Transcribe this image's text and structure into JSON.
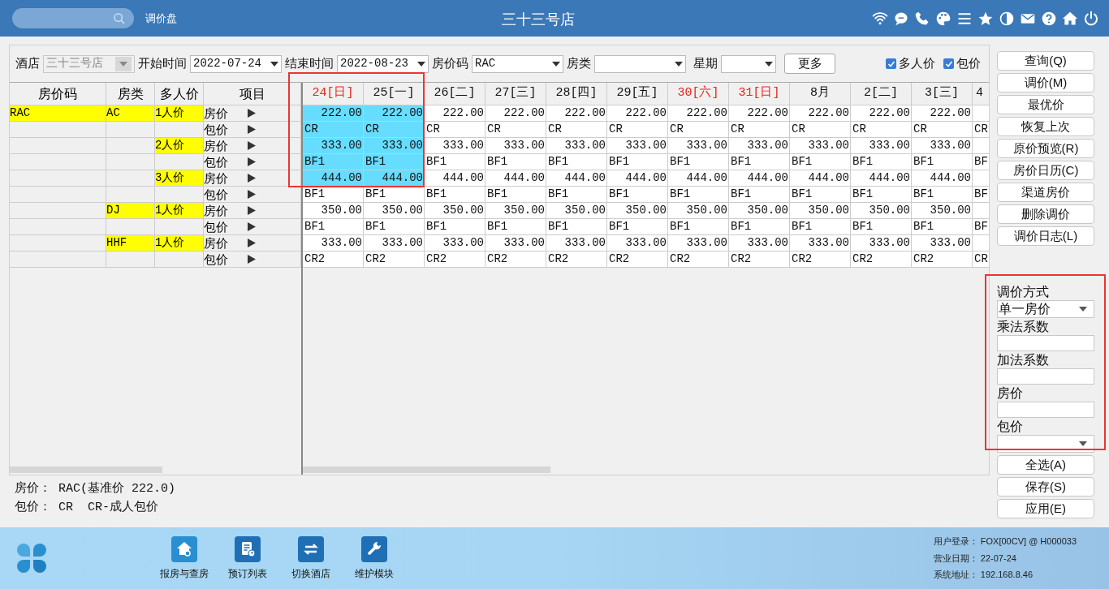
{
  "topbar": {
    "module_title": "调价盘",
    "store_title": "三十三号店"
  },
  "filters": {
    "hotel": {
      "label": "酒店",
      "value": "三十三号店",
      "disabled": true
    },
    "start": {
      "label": "开始时间",
      "value": "2022-07-24"
    },
    "end": {
      "label": "结束时间",
      "value": "2022-08-23"
    },
    "rate_code": {
      "label": "房价码",
      "value": "RAC"
    },
    "room_type": {
      "label": "房类"
    },
    "weekday": {
      "label": "星期"
    },
    "more_button": "更多",
    "checkboxes": [
      {
        "label": "多人价",
        "checked": true
      },
      {
        "label": "包价",
        "checked": true
      }
    ]
  },
  "left_columns": [
    "房价码",
    "房类",
    "多人价",
    "项目"
  ],
  "dates": [
    {
      "label": "24[日]",
      "weekend": true
    },
    {
      "label": "25[一]",
      "weekend": false
    },
    {
      "label": "26[二]",
      "weekend": false
    },
    {
      "label": "27[三]",
      "weekend": false
    },
    {
      "label": "28[四]",
      "weekend": false
    },
    {
      "label": "29[五]",
      "weekend": false
    },
    {
      "label": "30[六]",
      "weekend": true
    },
    {
      "label": "31[日]",
      "weekend": true
    },
    {
      "label": "8月",
      "weekend": false
    },
    {
      "label": "2[二]",
      "weekend": false
    },
    {
      "label": "3[三]",
      "weekend": false
    },
    {
      "label": "4",
      "weekend": false
    }
  ],
  "rows": [
    {
      "kind": "rate",
      "code": "RAC",
      "room_type": "AC",
      "persons": "1人价",
      "item": "房价",
      "cells": [
        {
          "text": "222.00",
          "selected": true
        },
        {
          "text": "222.00",
          "selected": true
        },
        {
          "text": "222.00",
          "selected": false
        },
        {
          "text": "222.00",
          "selected": false
        },
        {
          "text": "222.00",
          "selected": false
        },
        {
          "text": "222.00",
          "selected": false
        },
        {
          "text": "222.00",
          "selected": false
        },
        {
          "text": "222.00",
          "selected": false
        },
        {
          "text": "222.00",
          "selected": false
        },
        {
          "text": "222.00",
          "selected": false
        },
        {
          "text": "222.00",
          "selected": false
        }
      ]
    },
    {
      "kind": "package",
      "item": "包价",
      "cells": [
        {
          "text": "CR",
          "selected": true
        },
        {
          "text": "CR",
          "selected": true
        },
        {
          "text": "CR",
          "selected": false
        },
        {
          "text": "CR",
          "selected": false
        },
        {
          "text": "CR",
          "selected": false
        },
        {
          "text": "CR",
          "selected": false
        },
        {
          "text": "CR",
          "selected": false
        },
        {
          "text": "CR",
          "selected": false
        },
        {
          "text": "CR",
          "selected": false
        },
        {
          "text": "CR",
          "selected": false
        },
        {
          "text": "CR",
          "selected": false
        },
        {
          "text": "CR",
          "selected": false
        }
      ]
    },
    {
      "kind": "rate",
      "persons": "2人价",
      "item": "房价",
      "cells": [
        {
          "text": "333.00",
          "selected": true
        },
        {
          "text": "333.00",
          "selected": true
        },
        {
          "text": "333.00",
          "selected": false
        },
        {
          "text": "333.00",
          "selected": false
        },
        {
          "text": "333.00",
          "selected": false
        },
        {
          "text": "333.00",
          "selected": false
        },
        {
          "text": "333.00",
          "selected": false
        },
        {
          "text": "333.00",
          "selected": false
        },
        {
          "text": "333.00",
          "selected": false
        },
        {
          "text": "333.00",
          "selected": false
        },
        {
          "text": "333.00",
          "selected": false
        }
      ]
    },
    {
      "kind": "package",
      "item": "包价",
      "cells": [
        {
          "text": "BF1",
          "selected": true
        },
        {
          "text": "BF1",
          "selected": true
        },
        {
          "text": "BF1",
          "selected": false
        },
        {
          "text": "BF1",
          "selected": false
        },
        {
          "text": "BF1",
          "selected": false
        },
        {
          "text": "BF1",
          "selected": false
        },
        {
          "text": "BF1",
          "selected": false
        },
        {
          "text": "BF1",
          "selected": false
        },
        {
          "text": "BF1",
          "selected": false
        },
        {
          "text": "BF1",
          "selected": false
        },
        {
          "text": "BF1",
          "selected": false
        },
        {
          "text": "BF",
          "selected": false
        }
      ]
    },
    {
      "kind": "rate",
      "persons": "3人价",
      "item": "房价",
      "cells": [
        {
          "text": "444.00",
          "selected": true
        },
        {
          "text": "444.00",
          "selected": true
        },
        {
          "text": "444.00",
          "selected": false
        },
        {
          "text": "444.00",
          "selected": false
        },
        {
          "text": "444.00",
          "selected": false
        },
        {
          "text": "444.00",
          "selected": false
        },
        {
          "text": "444.00",
          "selected": false
        },
        {
          "text": "444.00",
          "selected": false
        },
        {
          "text": "444.00",
          "selected": false
        },
        {
          "text": "444.00",
          "selected": false
        },
        {
          "text": "444.00",
          "selected": false
        }
      ]
    },
    {
      "kind": "package",
      "item": "包价",
      "cells": [
        {
          "text": "BF1",
          "selected": false
        },
        {
          "text": "BF1",
          "selected": false
        },
        {
          "text": "BF1",
          "selected": false
        },
        {
          "text": "BF1",
          "selected": false
        },
        {
          "text": "BF1",
          "selected": false
        },
        {
          "text": "BF1",
          "selected": false
        },
        {
          "text": "BF1",
          "selected": false
        },
        {
          "text": "BF1",
          "selected": false
        },
        {
          "text": "BF1",
          "selected": false
        },
        {
          "text": "BF1",
          "selected": false
        },
        {
          "text": "BF1",
          "selected": false
        },
        {
          "text": "BF",
          "selected": false
        }
      ]
    },
    {
      "kind": "rate",
      "room_type": "DJ",
      "persons": "1人价",
      "item": "房价",
      "cells": [
        {
          "text": "350.00",
          "selected": false
        },
        {
          "text": "350.00",
          "selected": false
        },
        {
          "text": "350.00",
          "selected": false
        },
        {
          "text": "350.00",
          "selected": false
        },
        {
          "text": "350.00",
          "selected": false
        },
        {
          "text": "350.00",
          "selected": false
        },
        {
          "text": "350.00",
          "selected": false
        },
        {
          "text": "350.00",
          "selected": false
        },
        {
          "text": "350.00",
          "selected": false
        },
        {
          "text": "350.00",
          "selected": false
        },
        {
          "text": "350.00",
          "selected": false
        }
      ]
    },
    {
      "kind": "package",
      "item": "包价",
      "cells": [
        {
          "text": "BF1",
          "selected": false
        },
        {
          "text": "BF1",
          "selected": false
        },
        {
          "text": "BF1",
          "selected": false
        },
        {
          "text": "BF1",
          "selected": false
        },
        {
          "text": "BF1",
          "selected": false
        },
        {
          "text": "BF1",
          "selected": false
        },
        {
          "text": "BF1",
          "selected": false
        },
        {
          "text": "BF1",
          "selected": false
        },
        {
          "text": "BF1",
          "selected": false
        },
        {
          "text": "BF1",
          "selected": false
        },
        {
          "text": "BF1",
          "selected": false
        },
        {
          "text": "BF",
          "selected": false
        }
      ]
    },
    {
      "kind": "rate",
      "room_type": "HHF",
      "persons": "1人价",
      "item": "房价",
      "cells": [
        {
          "text": "333.00",
          "selected": false
        },
        {
          "text": "333.00",
          "selected": false
        },
        {
          "text": "333.00",
          "selected": false
        },
        {
          "text": "333.00",
          "selected": false
        },
        {
          "text": "333.00",
          "selected": false
        },
        {
          "text": "333.00",
          "selected": false
        },
        {
          "text": "333.00",
          "selected": false
        },
        {
          "text": "333.00",
          "selected": false
        },
        {
          "text": "333.00",
          "selected": false
        },
        {
          "text": "333.00",
          "selected": false
        },
        {
          "text": "333.00",
          "selected": false
        }
      ]
    },
    {
      "kind": "package",
      "item": "包价",
      "cells": [
        {
          "text": "CR2",
          "selected": false
        },
        {
          "text": "CR2",
          "selected": false
        },
        {
          "text": "CR2",
          "selected": false
        },
        {
          "text": "CR2",
          "selected": false
        },
        {
          "text": "CR2",
          "selected": false
        },
        {
          "text": "CR2",
          "selected": false
        },
        {
          "text": "CR2",
          "selected": false
        },
        {
          "text": "CR2",
          "selected": false
        },
        {
          "text": "CR2",
          "selected": false
        },
        {
          "text": "CR2",
          "selected": false
        },
        {
          "text": "CR2",
          "selected": false
        },
        {
          "text": "CR",
          "selected": false
        }
      ]
    }
  ],
  "legend": [
    "房价： RAC(基准价 222.0)",
    "包价： CR  CR-成人包价"
  ],
  "action_buttons": [
    "查询(Q)",
    "调价(M)",
    "最优价",
    "恢复上次",
    "原价预览(R)",
    "房价日历(C)",
    "渠道房价",
    "删除调价",
    "调价日志(L)"
  ],
  "adjust_panel": [
    {
      "label": "调价方式",
      "kind": "select",
      "value": "单一房价"
    },
    {
      "label": "乘法系数",
      "kind": "input"
    },
    {
      "label": "加法系数",
      "kind": "input"
    },
    {
      "label": "房价",
      "kind": "input"
    },
    {
      "label": "包价",
      "kind": "select"
    }
  ],
  "bottom_buttons": [
    "全选(A)",
    "保存(S)",
    "应用(E)"
  ],
  "taskbar": [
    {
      "kind": "house",
      "label": "报房与查房"
    },
    {
      "kind": "document",
      "label": "预订列表"
    },
    {
      "kind": "switch",
      "label": "切换酒店"
    },
    {
      "kind": "wrench",
      "label": "维护模块"
    }
  ],
  "info": [
    {
      "label": "用户登录：",
      "value": "FOX[00CV] @ H000033"
    },
    {
      "label": "营业日期：",
      "value": "22-07-24"
    },
    {
      "label": "系统地址：",
      "value": "192.168.8.46"
    }
  ]
}
